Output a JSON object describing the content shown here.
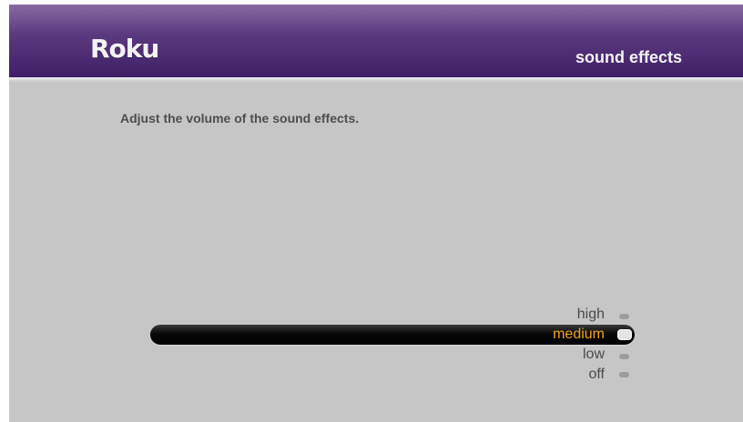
{
  "header": {
    "logo_text": "Roku",
    "title": "sound effects"
  },
  "main": {
    "instructions": "Adjust the volume of the sound effects."
  },
  "volume_setting": {
    "selected": "medium",
    "options": [
      {
        "label": "high"
      },
      {
        "label": "medium"
      },
      {
        "label": "low"
      },
      {
        "label": "off"
      }
    ]
  },
  "colors": {
    "header_purple": "#3e1e66",
    "background_gray": "#c6c6c6",
    "selected_accent": "#f0a418"
  }
}
